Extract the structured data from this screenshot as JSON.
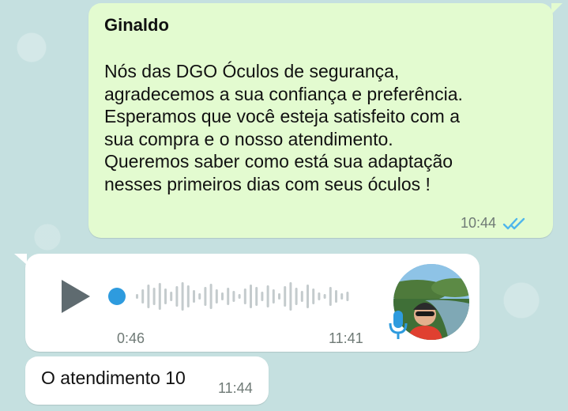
{
  "outgoing": {
    "sender": "Ginaldo",
    "text": "Nós das DGO Óculos de segurança,\nagradecemos a sua confiança e preferência.\nEsperamos que você esteja satisfeito com a\nsua compra e o nosso atendimento.\nQueremos saber como está sua adaptação\nnesses primeiros dias com seus óculos !",
    "time": "10:44",
    "status_icon": "double-check-read-icon"
  },
  "audio": {
    "duration": "0:46",
    "time": "11:41",
    "progress": 0,
    "play_icon": "play-icon",
    "mic_icon": "microphone-icon"
  },
  "incoming": {
    "text": "O atendimento 10",
    "time": "11:44"
  },
  "colors": {
    "wallpaper": "#c5e0e0",
    "outgoing_bubble": "#e3fbd0",
    "incoming_bubble": "#ffffff",
    "read_checks": "#4fb6ec",
    "accent_blue": "#2e9bde"
  }
}
